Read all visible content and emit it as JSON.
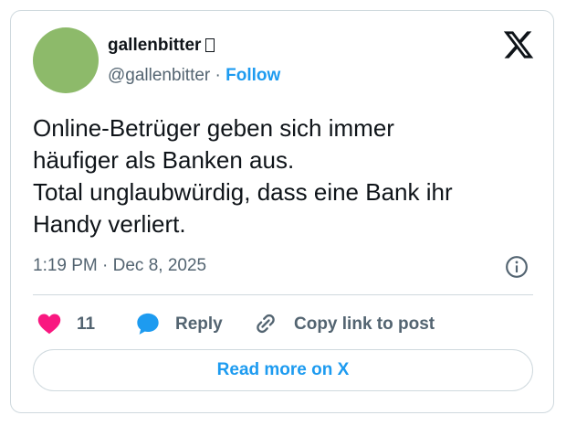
{
  "author": {
    "display_name": "gallenbitter",
    "handle": "@gallenbitter",
    "separator": " · ",
    "follow_label": "Follow",
    "avatar_color": "#8dba6a"
  },
  "tweet": {
    "lines": [
      "Online-Betrüger geben sich immer",
      "häufiger als Banken aus.",
      "Total unglaubwürdig, dass eine Bank ihr",
      "Handy verliert."
    ],
    "timestamp": "1:19 PM · Dec 8, 2025"
  },
  "actions": {
    "like_count": "11",
    "reply_label": "Reply",
    "copy_label": "Copy link to post"
  },
  "read_more_label": "Read more on X",
  "icons": {
    "logo": "x-logo-icon",
    "info": "info-icon",
    "like": "heart-icon",
    "reply": "speech-bubble-icon",
    "copy": "link-icon"
  },
  "colors": {
    "accent": "#1d9bf0",
    "like": "#f91880",
    "muted": "#536471",
    "text": "#0f1419",
    "border": "#cfd9de"
  }
}
